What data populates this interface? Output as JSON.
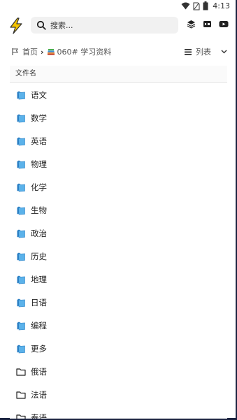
{
  "status_bar": {
    "time": "4:13"
  },
  "search": {
    "placeholder": "搜索..."
  },
  "breadcrumb": {
    "home": "首页",
    "current": "060# 学习资料"
  },
  "view_toggle": {
    "label": "列表"
  },
  "file_list": {
    "header": "文件名",
    "items": [
      {
        "name": "语文",
        "icon": "folder-filled-icon"
      },
      {
        "name": "数学",
        "icon": "folder-filled-icon"
      },
      {
        "name": "英语",
        "icon": "folder-filled-icon"
      },
      {
        "name": "物理",
        "icon": "folder-filled-icon"
      },
      {
        "name": "化学",
        "icon": "folder-filled-icon"
      },
      {
        "name": "生物",
        "icon": "folder-filled-icon"
      },
      {
        "name": "政治",
        "icon": "folder-filled-icon"
      },
      {
        "name": "历史",
        "icon": "folder-filled-icon"
      },
      {
        "name": "地理",
        "icon": "folder-filled-icon"
      },
      {
        "name": "日语",
        "icon": "folder-filled-icon"
      },
      {
        "name": "编程",
        "icon": "folder-filled-icon"
      },
      {
        "name": "更多",
        "icon": "folder-filled-icon"
      },
      {
        "name": "俄语",
        "icon": "folder-outline-icon"
      },
      {
        "name": "法语",
        "icon": "folder-outline-icon"
      },
      {
        "name": "泰语",
        "icon": "folder-outline-icon"
      }
    ]
  },
  "colors": {
    "folder_blue": "#4aa3e0",
    "frame": "#1b2340",
    "logo": "#f5c400"
  }
}
